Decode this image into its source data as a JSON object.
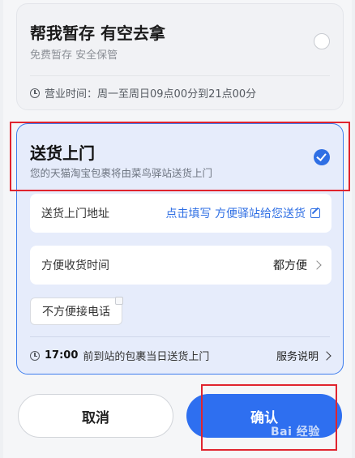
{
  "option_store": {
    "title": "帮我暂存 有空去拿",
    "subtitle": "免费暂存 安全保管",
    "hours": "营业时间：周一至周日09点00分到21点00分"
  },
  "option_delivery": {
    "title": "送货上门",
    "subtitle": "您的天猫淘宝包裹将由菜鸟驿站送货上门",
    "address_label": "送货上门地址",
    "address_action": "点击填写 方便驿站给您送货",
    "time_label": "方便收货时间",
    "time_value": "都方便",
    "phone_tag": "不方便接电话",
    "footer_time": "17:00",
    "footer_text": "前到站的包裹当日送货上门",
    "help_link": "服务说明"
  },
  "buttons": {
    "cancel": "取消",
    "confirm": "确认"
  },
  "watermark": "Bai 经验",
  "colors": {
    "accent": "#2e6ff0",
    "highlight": "#e0242e",
    "selected_bg": "#e6ecfb"
  }
}
